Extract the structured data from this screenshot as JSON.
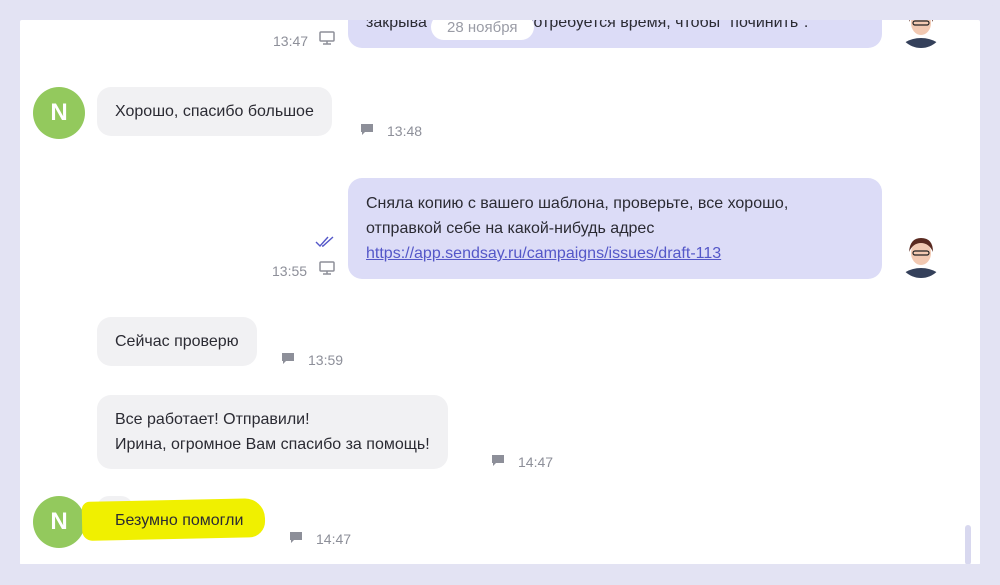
{
  "colors": {
    "accent": "#5457c8",
    "avatar_green": "#93c95d",
    "highlight": "#f0f000"
  },
  "date_divider": "28 ноября",
  "messages": [
    {
      "text": "закрыва",
      "text_after": "потребуется время, чтобы \"починить\".",
      "time": "13:47",
      "icon": "monitor-icon"
    },
    {
      "text": "Хорошо, спасибо большое",
      "time": "13:48",
      "icon": "chat-icon"
    },
    {
      "lines": [
        "Сняла копию с вашего шаблона, проверьте, все хорошо,",
        "отправкой себе на какой-нибудь адрес"
      ],
      "link": "https://app.sendsay.ru/campaigns/issues/draft-113",
      "time": "13:55",
      "icon": "monitor-icon"
    },
    {
      "text": "Сейчас проверю",
      "time": "13:59",
      "icon": "chat-icon"
    },
    {
      "lines": [
        "Все работает! Отправили!",
        "Ирина, огромное Вам спасибо за помощь!"
      ],
      "time": "14:47",
      "icon": "chat-icon"
    },
    {
      "text": "Безумно помогли",
      "time": "14:47",
      "icon": "chat-icon"
    }
  ],
  "avatars": {
    "client_letter": "N"
  }
}
